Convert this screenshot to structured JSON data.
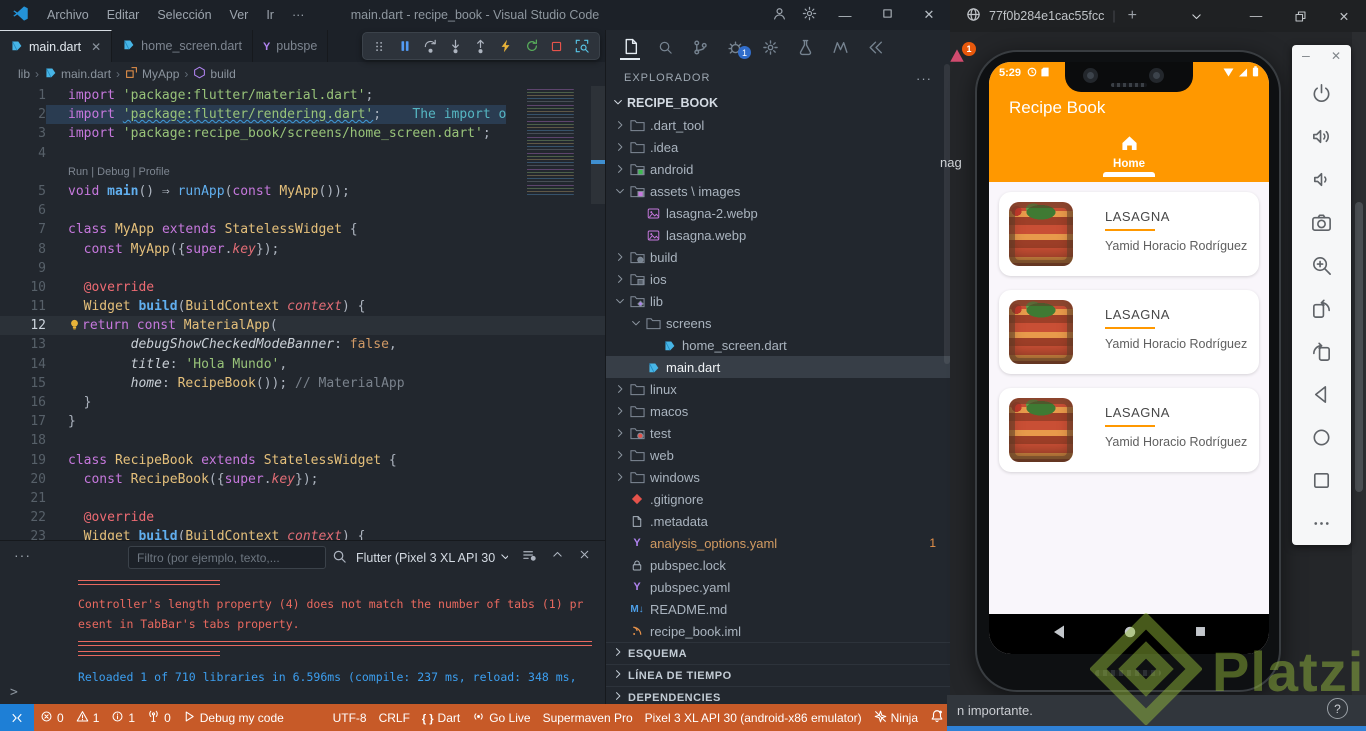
{
  "window": {
    "menu": [
      "Archivo",
      "Editar",
      "Selección",
      "Ver",
      "Ir",
      "···"
    ],
    "title": "main.dart - recipe_book - Visual Studio Code"
  },
  "tabs": [
    {
      "label": "main.dart",
      "icon": "dart",
      "active": true
    },
    {
      "label": "home_screen.dart",
      "icon": "dart",
      "active": false
    },
    {
      "label": "pubspe",
      "icon": "yaml",
      "active": false
    }
  ],
  "debug_toolbar": [
    "grip",
    "pause",
    "step-over",
    "step-into",
    "step-out",
    "hot-reload",
    "restart",
    "stop",
    "inspect-widget"
  ],
  "breadcrumb": [
    {
      "label": "lib",
      "icon": ""
    },
    {
      "label": "main.dart",
      "icon": "dart"
    },
    {
      "label": "MyApp",
      "icon": "symbol-class"
    },
    {
      "label": "build",
      "icon": "symbol-method"
    }
  ],
  "editor": {
    "code_lens": "Run | Debug | Profile",
    "lines": [
      {
        "n": "1",
        "seg": [
          [
            "k",
            "import"
          ],
          [
            "p",
            " "
          ],
          [
            "s",
            "'package:flutter/material.dart'"
          ],
          [
            "p",
            ";"
          ]
        ]
      },
      {
        "n": "2",
        "hl": true,
        "seg": [
          [
            "k",
            "import"
          ],
          [
            "p",
            " "
          ],
          [
            "sw",
            "'package:flutter/rendering.dart'"
          ],
          [
            "p",
            ";"
          ],
          [
            "p",
            "    "
          ],
          [
            "g",
            "The import o"
          ]
        ]
      },
      {
        "n": "3",
        "seg": [
          [
            "k",
            "import"
          ],
          [
            "p",
            " "
          ],
          [
            "s",
            "'package:recipe_book/screens/home_screen.dart'"
          ],
          [
            "p",
            ";"
          ]
        ]
      },
      {
        "n": "4",
        "seg": []
      },
      {
        "lens": true
      },
      {
        "n": "5",
        "seg": [
          [
            "k",
            "void"
          ],
          [
            "p",
            " "
          ],
          [
            "fb",
            "main"
          ],
          [
            "p",
            "() ⇒ "
          ],
          [
            "f",
            "runApp"
          ],
          [
            "p",
            "("
          ],
          [
            "k",
            "const"
          ],
          [
            "p",
            " "
          ],
          [
            "c",
            "MyApp"
          ],
          [
            "p",
            "());"
          ]
        ]
      },
      {
        "n": "6",
        "seg": []
      },
      {
        "n": "7",
        "seg": [
          [
            "k",
            "class"
          ],
          [
            "p",
            " "
          ],
          [
            "c",
            "MyApp"
          ],
          [
            "p",
            " "
          ],
          [
            "k",
            "extends"
          ],
          [
            "p",
            " "
          ],
          [
            "c",
            "StatelessWidget"
          ],
          [
            "p",
            " {"
          ]
        ]
      },
      {
        "n": "8",
        "seg": [
          [
            "p",
            "  "
          ],
          [
            "k",
            "const"
          ],
          [
            "p",
            " "
          ],
          [
            "c",
            "MyApp"
          ],
          [
            "p",
            "({"
          ],
          [
            "k",
            "super"
          ],
          [
            "p",
            "."
          ],
          [
            "i",
            "key"
          ],
          [
            "p",
            "});"
          ]
        ]
      },
      {
        "n": "9",
        "seg": []
      },
      {
        "n": "10",
        "seg": [
          [
            "p",
            "  "
          ],
          [
            "a",
            "@override"
          ]
        ]
      },
      {
        "n": "11",
        "seg": [
          [
            "p",
            "  "
          ],
          [
            "c",
            "Widget"
          ],
          [
            "p",
            " "
          ],
          [
            "fb",
            "build"
          ],
          [
            "p",
            "("
          ],
          [
            "c",
            "BuildContext"
          ],
          [
            "p",
            " "
          ],
          [
            "i",
            "context"
          ],
          [
            "p",
            ") {"
          ]
        ]
      },
      {
        "n": "12",
        "cur": true,
        "seg": [
          [
            "k",
            "return"
          ],
          [
            "p",
            " "
          ],
          [
            "k",
            "const"
          ],
          [
            "p",
            " "
          ],
          [
            "c",
            "MaterialApp"
          ],
          [
            "p",
            "("
          ]
        ]
      },
      {
        "n": "13",
        "seg": [
          [
            "p",
            "        "
          ],
          [
            "pr",
            "debugShowCheckedModeBanner"
          ],
          [
            "p",
            ": "
          ],
          [
            "num",
            "false"
          ],
          [
            "p",
            ","
          ]
        ]
      },
      {
        "n": "14",
        "seg": [
          [
            "p",
            "        "
          ],
          [
            "pr",
            "title"
          ],
          [
            "p",
            ": "
          ],
          [
            "s",
            "'Hola Mundo'"
          ],
          [
            "p",
            ","
          ]
        ]
      },
      {
        "n": "15",
        "seg": [
          [
            "p",
            "        "
          ],
          [
            "pr",
            "home"
          ],
          [
            "p",
            ": "
          ],
          [
            "c",
            "RecipeBook"
          ],
          [
            "p",
            "()); "
          ],
          [
            "cm",
            "// MaterialApp"
          ]
        ]
      },
      {
        "n": "16",
        "seg": [
          [
            "p",
            "  }"
          ]
        ]
      },
      {
        "n": "17",
        "seg": [
          [
            "p",
            "}"
          ]
        ]
      },
      {
        "n": "18",
        "seg": []
      },
      {
        "n": "19",
        "seg": [
          [
            "k",
            "class"
          ],
          [
            "p",
            " "
          ],
          [
            "c",
            "RecipeBook"
          ],
          [
            "p",
            " "
          ],
          [
            "k",
            "extends"
          ],
          [
            "p",
            " "
          ],
          [
            "c",
            "StatelessWidget"
          ],
          [
            "p",
            " {"
          ]
        ]
      },
      {
        "n": "20",
        "seg": [
          [
            "p",
            "  "
          ],
          [
            "k",
            "const"
          ],
          [
            "p",
            " "
          ],
          [
            "c",
            "RecipeBook"
          ],
          [
            "p",
            "({"
          ],
          [
            "k",
            "super"
          ],
          [
            "p",
            "."
          ],
          [
            "i",
            "key"
          ],
          [
            "p",
            "});"
          ]
        ]
      },
      {
        "n": "21",
        "seg": []
      },
      {
        "n": "22",
        "seg": [
          [
            "p",
            "  "
          ],
          [
            "a",
            "@override"
          ]
        ]
      },
      {
        "n": "23",
        "seg": [
          [
            "p",
            "  "
          ],
          [
            "c",
            "Widget"
          ],
          [
            "p",
            " "
          ],
          [
            "fb",
            "build"
          ],
          [
            "p",
            "("
          ],
          [
            "c",
            "BuildContext"
          ],
          [
            "p",
            " "
          ],
          [
            "i",
            "context"
          ],
          [
            "p",
            ") {"
          ]
        ]
      }
    ]
  },
  "panel": {
    "more": "···",
    "filter_placeholder": "Filtro (por ejemplo, texto,...",
    "device_selector": "Flutter (Pixel 3 XL API 30",
    "console": [
      {
        "type": "sep-short"
      },
      {
        "type": "error",
        "text": "Controller's length property (4) does not match the number of tabs (1) pr"
      },
      {
        "type": "error",
        "text": "esent in TabBar's tabs property."
      },
      {
        "type": "sep-full"
      },
      {
        "type": "sep-short"
      },
      {
        "type": "info",
        "text": "Reloaded 1 of 710 libraries in 6.596ms (compile: 237 ms, reload: 348 ms,"
      }
    ],
    "prompt": ">"
  },
  "status_bar": {
    "left": [
      {
        "icon": "error",
        "label": "0"
      },
      {
        "icon": "warning",
        "label": "1"
      },
      {
        "icon": "info",
        "label": "1"
      },
      {
        "icon": "tower",
        "label": "0"
      },
      {
        "icon": "debug-play",
        "label": "Debug my code"
      }
    ],
    "right": [
      {
        "icon": "",
        "label": "UTF-8"
      },
      {
        "icon": "",
        "label": "CRLF"
      },
      {
        "icon": "braces",
        "label": "Dart"
      },
      {
        "icon": "broadcast",
        "label": "Go Live"
      },
      {
        "icon": "",
        "label": "Supermaven Pro"
      },
      {
        "icon": "",
        "label": "Pixel 3 XL API 30 (android-x86 emulator)"
      },
      {
        "icon": "ninja",
        "label": "Ninja"
      },
      {
        "icon": "bell",
        "label": ""
      }
    ]
  },
  "activity_bar": [
    {
      "name": "files",
      "active": true
    },
    {
      "name": "search"
    },
    {
      "name": "source-control"
    },
    {
      "name": "debug",
      "badge": "1"
    },
    {
      "name": "extensions"
    },
    {
      "name": "testing"
    },
    {
      "name": "supermaven"
    },
    {
      "name": "collapse"
    }
  ],
  "explorer": {
    "header": "EXPLORADOR",
    "root": "RECIPE_BOOK",
    "rows": [
      {
        "label": ".dart_tool",
        "depth": 1,
        "kind": "folder",
        "variant": "plain",
        "chev": ">"
      },
      {
        "label": ".idea",
        "depth": 1,
        "kind": "folder",
        "variant": "plain",
        "chev": ">"
      },
      {
        "label": "android",
        "depth": 1,
        "kind": "folder",
        "variant": "android",
        "chev": ">"
      },
      {
        "label": "assets \\ images",
        "depth": 1,
        "kind": "folder",
        "variant": "assets",
        "chev": "v"
      },
      {
        "label": "lasagna-2.webp",
        "depth": 2,
        "kind": "file",
        "variant": "image"
      },
      {
        "label": "lasagna.webp",
        "depth": 2,
        "kind": "file",
        "variant": "image"
      },
      {
        "label": "build",
        "depth": 1,
        "kind": "folder",
        "variant": "build",
        "chev": ">"
      },
      {
        "label": "ios",
        "depth": 1,
        "kind": "folder",
        "variant": "ios",
        "chev": ">"
      },
      {
        "label": "lib",
        "depth": 1,
        "kind": "folder",
        "variant": "lib",
        "chev": "v"
      },
      {
        "label": "screens",
        "depth": 2,
        "kind": "folder",
        "variant": "plain",
        "chev": "v"
      },
      {
        "label": "home_screen.dart",
        "depth": 3,
        "kind": "file",
        "variant": "dart"
      },
      {
        "label": "main.dart",
        "depth": 2,
        "kind": "file",
        "variant": "dart",
        "selected": true
      },
      {
        "label": "linux",
        "depth": 1,
        "kind": "folder",
        "variant": "plain",
        "chev": ">"
      },
      {
        "label": "macos",
        "depth": 1,
        "kind": "folder",
        "variant": "plain",
        "chev": ">"
      },
      {
        "label": "test",
        "depth": 1,
        "kind": "folder",
        "variant": "test",
        "chev": ">"
      },
      {
        "label": "web",
        "depth": 1,
        "kind": "folder",
        "variant": "plain",
        "chev": ">"
      },
      {
        "label": "windows",
        "depth": 1,
        "kind": "folder",
        "variant": "plain",
        "chev": ">"
      },
      {
        "label": ".gitignore",
        "depth": 1,
        "kind": "file",
        "variant": "git"
      },
      {
        "label": ".metadata",
        "depth": 1,
        "kind": "file",
        "variant": "plain"
      },
      {
        "label": "analysis_options.yaml",
        "depth": 1,
        "kind": "file",
        "variant": "yaml",
        "warn": true,
        "badge": "1"
      },
      {
        "label": "pubspec.lock",
        "depth": 1,
        "kind": "file",
        "variant": "lock"
      },
      {
        "label": "pubspec.yaml",
        "depth": 1,
        "kind": "file",
        "variant": "yaml"
      },
      {
        "label": "README.md",
        "depth": 1,
        "kind": "file",
        "variant": "md"
      },
      {
        "label": "recipe_book.iml",
        "depth": 1,
        "kind": "file",
        "variant": "iml"
      }
    ],
    "sections": [
      "ESQUEMA",
      "LÍNEA DE TIEMPO",
      "DEPENDENCIES"
    ]
  },
  "emulator": {
    "title": "77f0b284e1cac55fcc",
    "phone": {
      "time": "5:29",
      "app_title": "Recipe Book",
      "tab_label": "Home",
      "recipes": [
        {
          "title": "LASAGNA",
          "author": "Yamid Horacio Rodríguez"
        },
        {
          "title": "LASAGNA",
          "author": "Yamid Horacio Rodríguez"
        },
        {
          "title": "LASAGNA",
          "author": "Yamid Horacio Rodríguez"
        }
      ]
    },
    "controls": [
      "power",
      "volume-up",
      "volume-down",
      "screenshot",
      "zoom",
      "rotate-left",
      "rotate-right",
      "back",
      "home",
      "overview",
      "more"
    ]
  },
  "toast": {
    "text": "n importante.",
    "help": "?"
  },
  "watermark": "Platzi",
  "fragments": {
    "hidden_text": "nag",
    "alert_badge": "1"
  },
  "colors": {
    "app_accent": "#FF9800",
    "status_bar_debugging": "#C75A28",
    "error_text": "#E9695F",
    "info_text": "#3C9FF0",
    "platzi_green": "#9DC53D"
  }
}
